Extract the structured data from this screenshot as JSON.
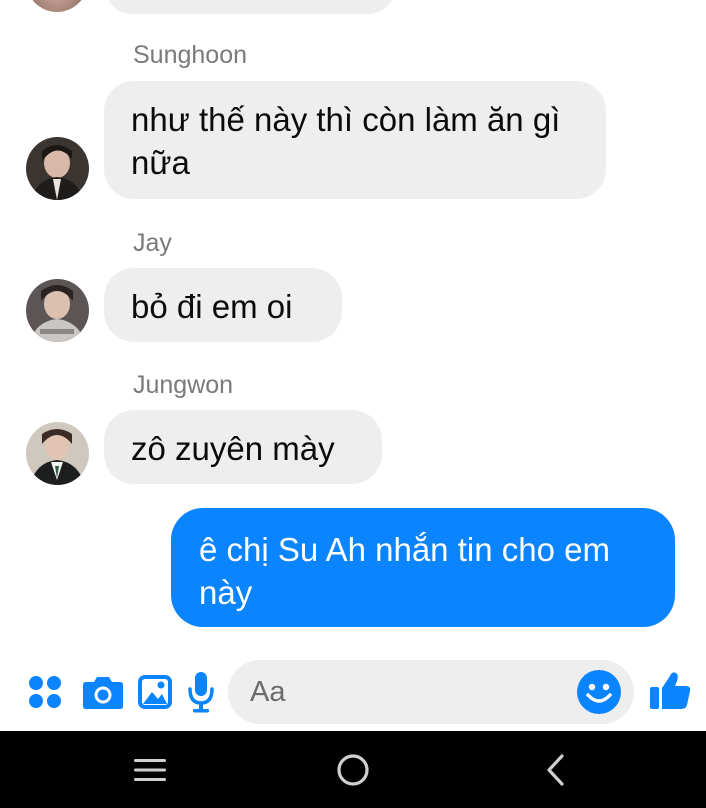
{
  "messages": [
    {
      "sender": "Sunghoon",
      "text": "như thế này thì còn làm ăn gì nữa",
      "avatar_icon": "sunghoon-avatar"
    },
    {
      "sender": "Jay",
      "text": "bỏ đi em oi",
      "avatar_icon": "jay-avatar"
    },
    {
      "sender": "Jungwon",
      "text": "zô zuyên mày",
      "avatar_icon": "jungwon-avatar"
    },
    {
      "sender": "me",
      "text": "ê chị Su Ah nhắn tin cho em này"
    }
  ],
  "composer": {
    "placeholder": "Aa",
    "icons": [
      "apps-icon",
      "camera-icon",
      "gallery-icon",
      "microphone-icon",
      "emoji-icon",
      "thumbs-up-icon"
    ]
  },
  "navbar": {
    "icons": [
      "recent-apps-icon",
      "home-icon",
      "back-icon"
    ]
  },
  "colors": {
    "accent": "#0a84ff",
    "bubble_incoming": "#eeeeee",
    "navbar": "#000000"
  }
}
